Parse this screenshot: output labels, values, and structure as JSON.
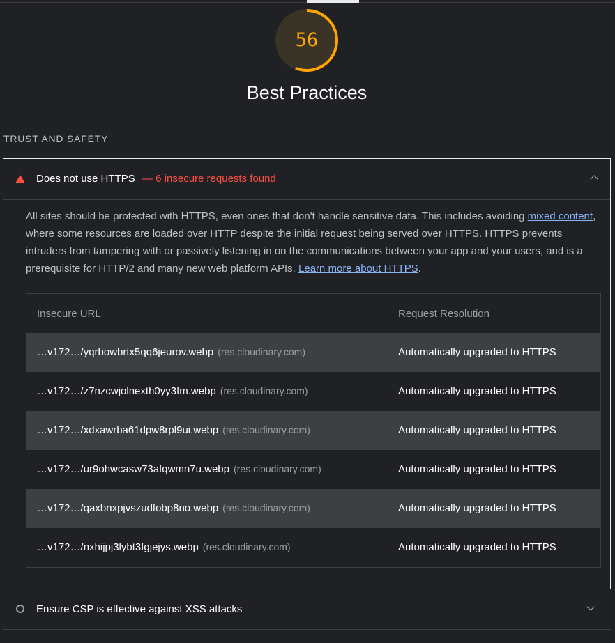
{
  "category": {
    "score": "56",
    "score_fraction": 0.56,
    "title": "Best Practices",
    "gauge_color": "#ffa400"
  },
  "group": {
    "title": "TRUST AND SAFETY"
  },
  "audit_https": {
    "title": "Does not use HTTPS",
    "display_value": "— 6 insecure requests found",
    "status_icon": "fail-triangle-icon",
    "status_color": "#ff4e42",
    "description": {
      "part1": "All sites should be protected with HTTPS, even ones that don't handle sensitive data. This includes avoiding ",
      "link1": "mixed content",
      "part2": ", where some resources are loaded over HTTP despite the initial request being served over HTTPS. HTTPS prevents intruders from tampering with or passively listening in on the communications between your app and your users, and is a prerequisite for HTTP/2 and many new web platform APIs. ",
      "link2": "Learn more about HTTPS",
      "part3": "."
    },
    "table": {
      "headers": {
        "url": "Insecure URL",
        "resolution": "Request Resolution"
      },
      "rows": [
        {
          "url": "…v172…/yqrbowbrtx5qq6jeurov.webp",
          "host": "(res.cloudinary.com)",
          "resolution": "Automatically upgraded to HTTPS"
        },
        {
          "url": "…v172…/z7nzcwjolnexth0yy3fm.webp",
          "host": "(res.cloudinary.com)",
          "resolution": "Automatically upgraded to HTTPS"
        },
        {
          "url": "…v172…/xdxawrba61dpw8rpl9ui.webp",
          "host": "(res.cloudinary.com)",
          "resolution": "Automatically upgraded to HTTPS"
        },
        {
          "url": "…v172…/ur9ohwcasw73afqwmn7u.webp",
          "host": "(res.cloudinary.com)",
          "resolution": "Automatically upgraded to HTTPS"
        },
        {
          "url": "…v172…/qaxbnxpjvszudfobp8no.webp",
          "host": "(res.cloudinary.com)",
          "resolution": "Automatically upgraded to HTTPS"
        },
        {
          "url": "…v172…/nxhijpj3lybt3fgjejys.webp",
          "host": "(res.cloudinary.com)",
          "resolution": "Automatically upgraded to HTTPS"
        }
      ]
    }
  },
  "audit_csp": {
    "title": "Ensure CSP is effective against XSS attacks",
    "status_icon": "informative-circle-icon"
  }
}
